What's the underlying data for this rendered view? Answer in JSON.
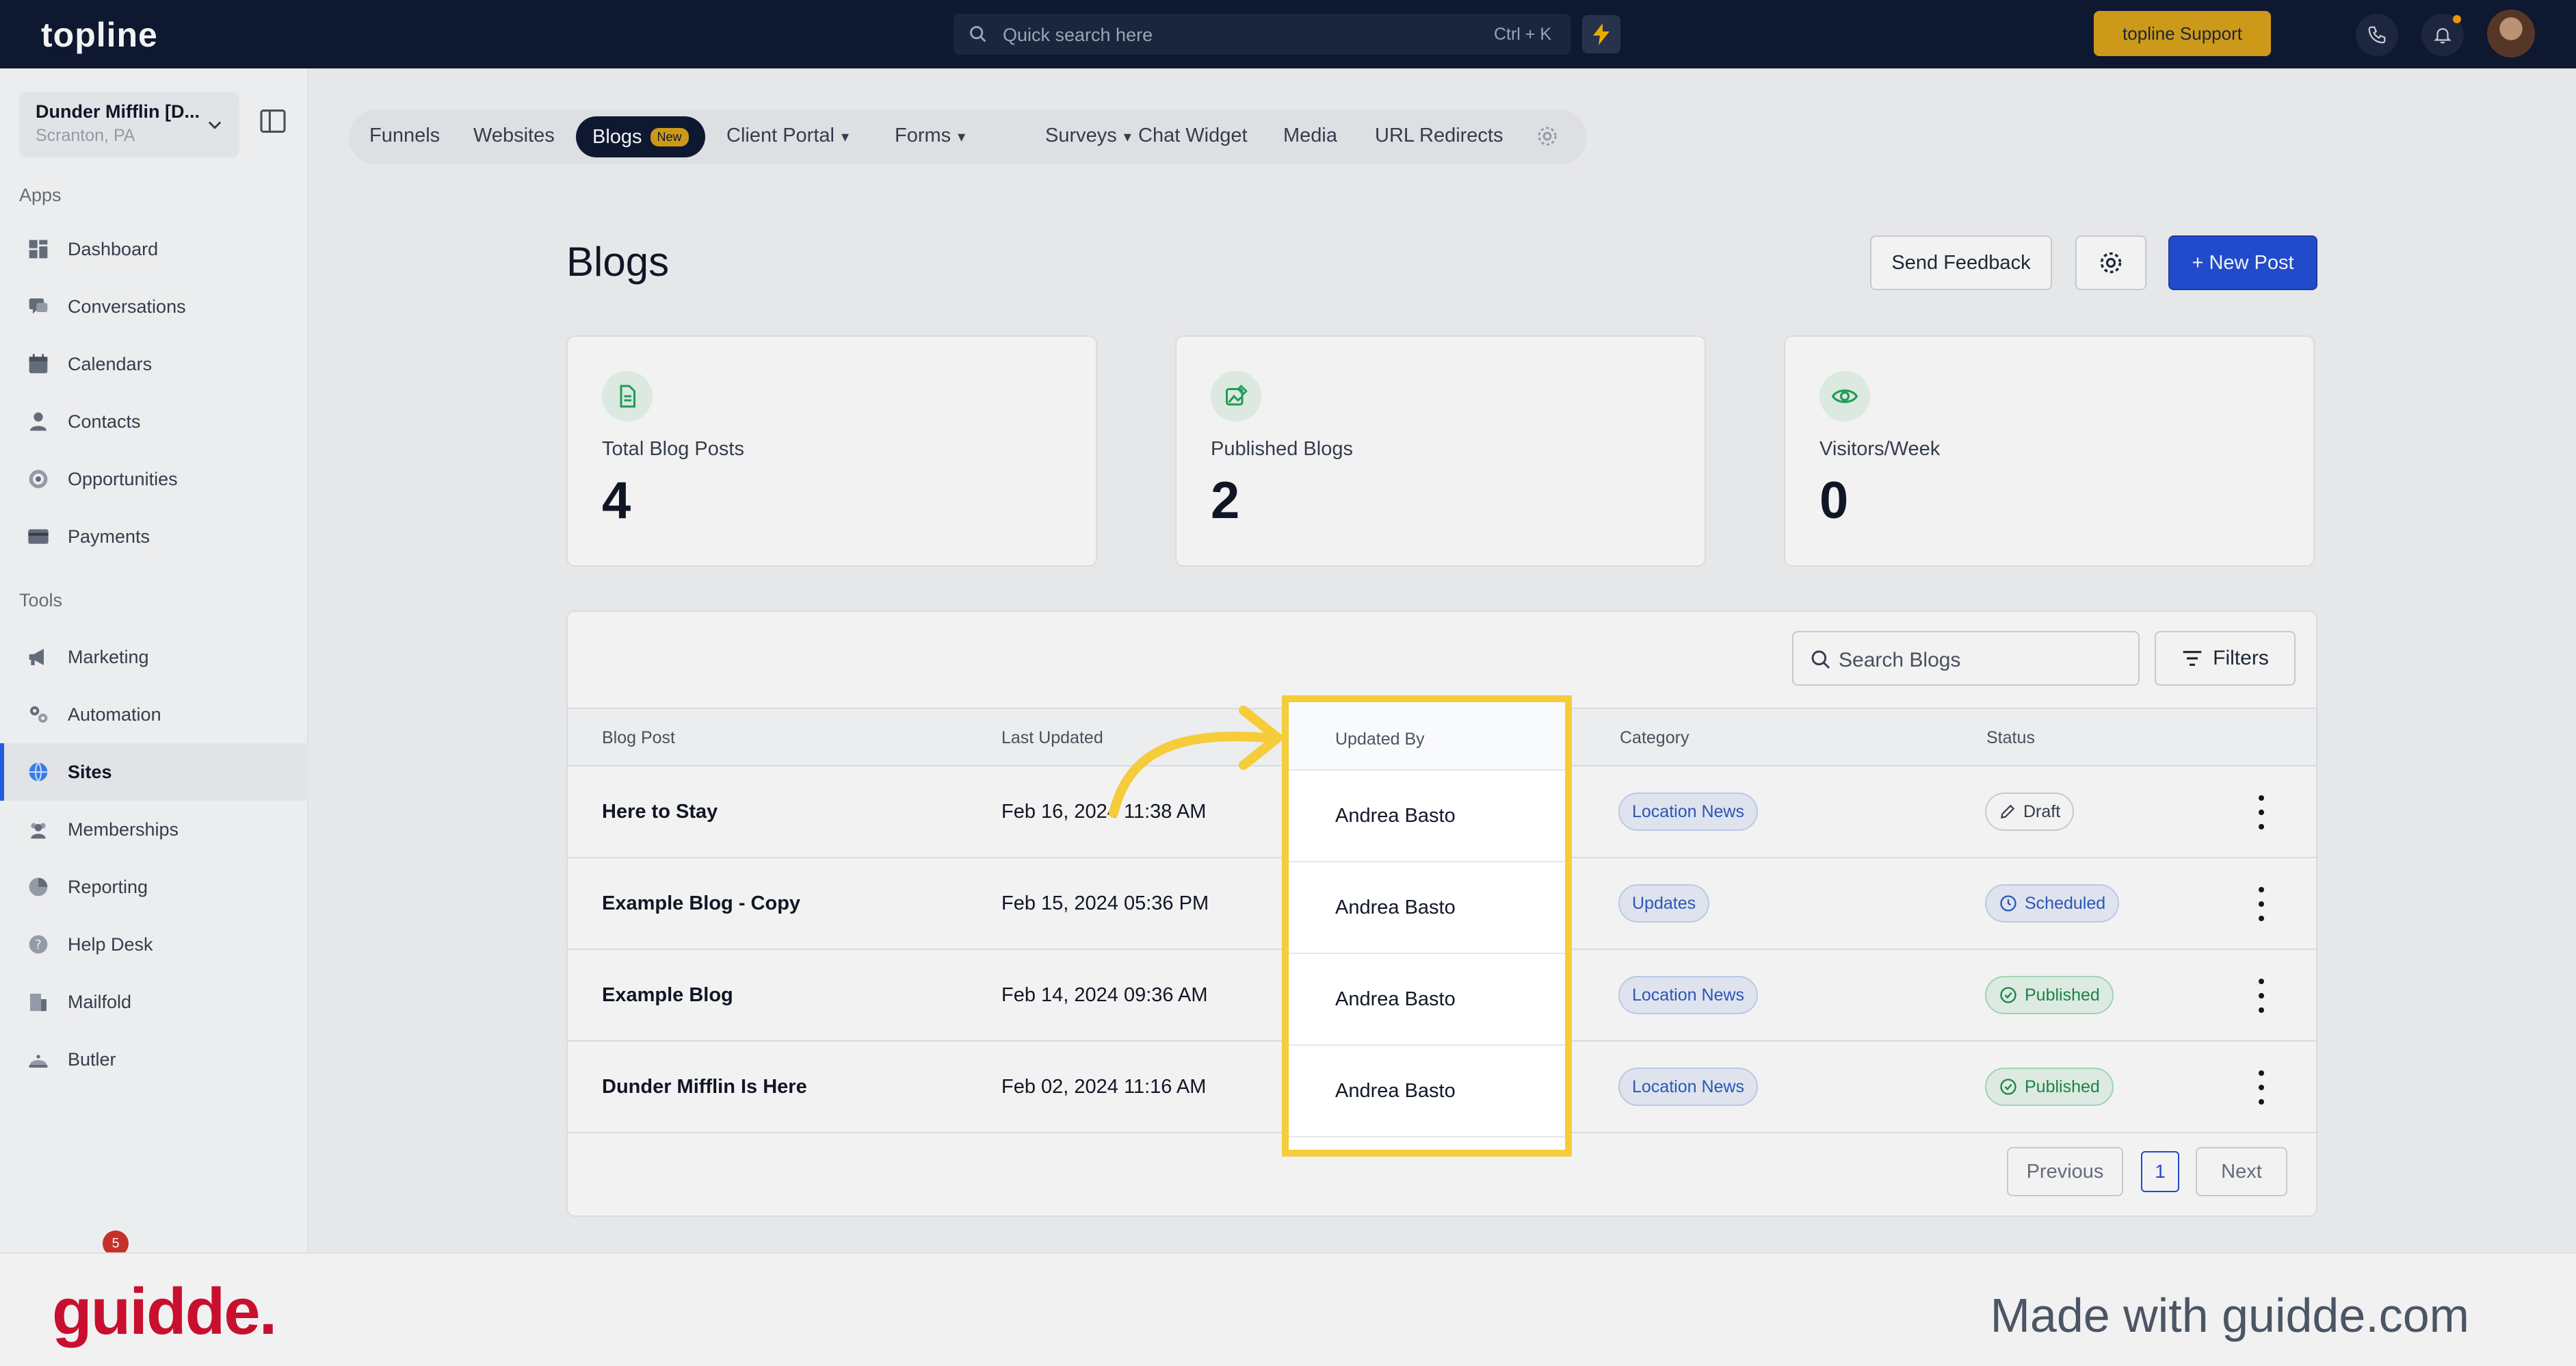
{
  "topbar": {
    "logo": "topline",
    "search_placeholder": "Quick search here",
    "search_shortcut": "Ctrl + K",
    "support_label": "topline Support"
  },
  "sidebar": {
    "account_name": "Dunder Mifflin [D...",
    "account_location": "Scranton, PA",
    "apps_label": "Apps",
    "tools_label": "Tools",
    "apps": [
      {
        "label": "Dashboard",
        "icon": "dashboard-icon"
      },
      {
        "label": "Conversations",
        "icon": "chat-icon"
      },
      {
        "label": "Calendars",
        "icon": "calendar-icon"
      },
      {
        "label": "Contacts",
        "icon": "person-icon"
      },
      {
        "label": "Opportunities",
        "icon": "target-icon"
      },
      {
        "label": "Payments",
        "icon": "card-icon"
      }
    ],
    "tools": [
      {
        "label": "Marketing",
        "icon": "megaphone-icon"
      },
      {
        "label": "Automation",
        "icon": "gears-icon"
      },
      {
        "label": "Sites",
        "icon": "globe-icon",
        "active": true
      },
      {
        "label": "Memberships",
        "icon": "group-icon"
      },
      {
        "label": "Reporting",
        "icon": "pie-icon"
      },
      {
        "label": "Help Desk",
        "icon": "help-icon"
      },
      {
        "label": "Mailfold",
        "icon": "building-icon"
      },
      {
        "label": "Butler",
        "icon": "bell-icon"
      }
    ],
    "notification_count": "5"
  },
  "tabs": {
    "items": [
      "Funnels",
      "Websites",
      "Blogs",
      "Client Portal",
      "Forms",
      "Surveys",
      "Chat Widget",
      "Media",
      "URL Redirects"
    ],
    "active_badge": "New"
  },
  "page": {
    "title": "Blogs",
    "send_feedback": "Send Feedback",
    "new_post": "+ New Post"
  },
  "stats": [
    {
      "label": "Total Blog Posts",
      "value": "4"
    },
    {
      "label": "Published Blogs",
      "value": "2"
    },
    {
      "label": "Visitors/Week",
      "value": "0"
    }
  ],
  "table": {
    "search_placeholder": "Search Blogs",
    "filters_label": "Filters",
    "columns": [
      "Blog Post",
      "Last Updated",
      "Updated By",
      "Category",
      "Status"
    ],
    "rows": [
      {
        "title": "Here to Stay",
        "updated": "Feb 16, 2024 11:38 AM",
        "by": "Andrea Basto",
        "category": "Location News",
        "status": "Draft"
      },
      {
        "title": "Example Blog - Copy",
        "updated": "Feb 15, 2024 05:36 PM",
        "by": "Andrea Basto",
        "category": "Updates",
        "status": "Scheduled"
      },
      {
        "title": "Example Blog",
        "updated": "Feb 14, 2024 09:36 AM",
        "by": "Andrea Basto",
        "category": "Location News",
        "status": "Published"
      },
      {
        "title": "Dunder Mifflin Is Here",
        "updated": "Feb 02, 2024 11:16 AM",
        "by": "Andrea Basto",
        "category": "Location News",
        "status": "Published"
      }
    ],
    "pager": {
      "previous": "Previous",
      "page": "1",
      "next": "Next"
    }
  },
  "banner": {
    "brand": "guidde.",
    "made_with": "Made with guidde.com"
  },
  "colors": {
    "topbar": "#0f1a33",
    "accent": "#2450d6",
    "support": "#d9a21b",
    "highlight": "#f5cc3a",
    "brand_red": "#c8102e"
  }
}
